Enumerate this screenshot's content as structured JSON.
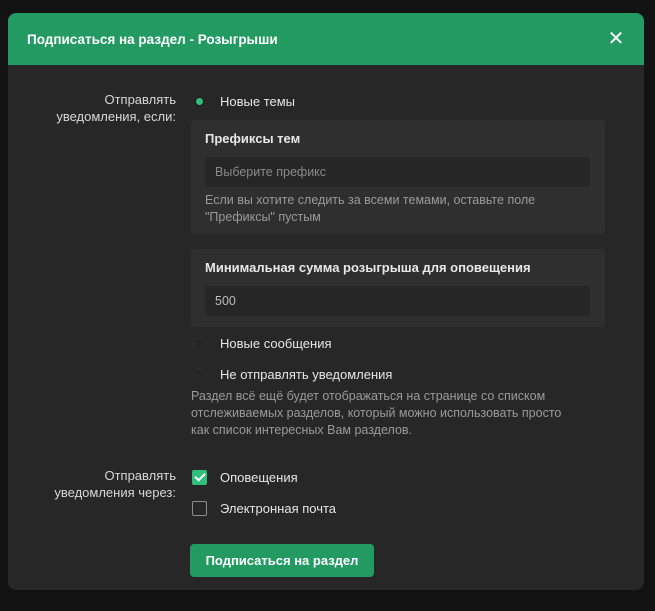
{
  "modal": {
    "title": "Подписаться на раздел - Розыгрыши",
    "close_symbol": "✕"
  },
  "notify_when": {
    "label_line1": "Отправлять",
    "label_line2": "уведомления, если:",
    "options": [
      {
        "label": "Новые темы",
        "selected": true
      },
      {
        "label": "Новые сообщения",
        "selected": false
      },
      {
        "label": "Не отправлять уведомления",
        "selected": false
      }
    ],
    "prefix_panel": {
      "title": "Префиксы тем",
      "placeholder": "Выберите префикс",
      "hint_line1": "Если вы хотите следить за всеми темами, оставьте поле",
      "hint_line2": "\"Префиксы\" пустым"
    },
    "min_sum_panel": {
      "title": "Минимальная сумма розыгрыша для оповещения",
      "value": "500"
    },
    "none_hint_line1": "Раздел всё ещё будет отображаться на странице со списком",
    "none_hint_line2": "отслеживаемых разделов, который можно использовать просто",
    "none_hint_line3": "как список интересных Вам разделов."
  },
  "notify_via": {
    "label_line1": "Отправлять",
    "label_line2": "уведомления через:",
    "options": [
      {
        "label": "Оповещения",
        "checked": true
      },
      {
        "label": "Электронная почта",
        "checked": false
      }
    ]
  },
  "submit_label": "Подписаться на раздел",
  "colors": {
    "accent": "#229a62",
    "radio_dot": "#2fbf7a",
    "panel": "#272727"
  }
}
